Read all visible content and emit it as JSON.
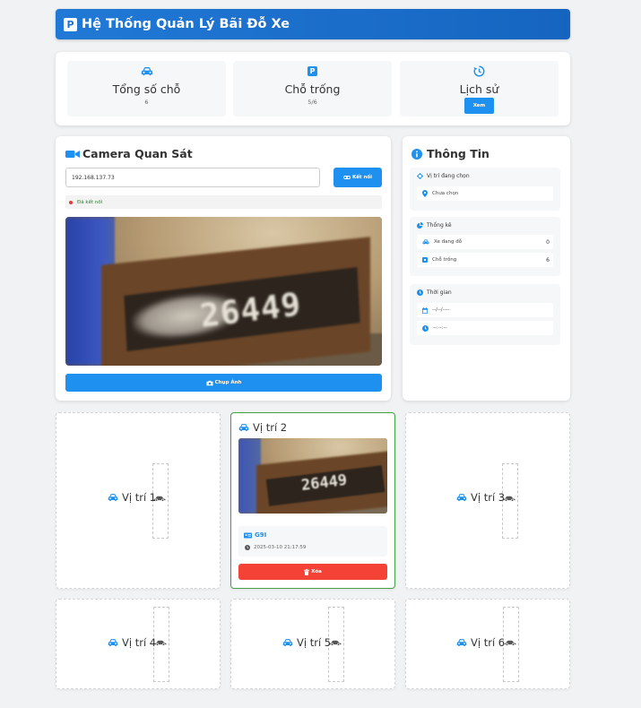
{
  "header": {
    "title": "Hệ Thống Quản Lý Bãi Đỗ Xe",
    "logo": "P"
  },
  "stats": {
    "total": {
      "label": "Tổng số chỗ",
      "value": "6"
    },
    "free": {
      "label": "Chỗ trống",
      "value": "5/6"
    },
    "history": {
      "label": "Lịch sử",
      "button": "Xem"
    }
  },
  "camera": {
    "title": "Camera Quan Sát",
    "ip_value": "192.168.137.73",
    "connect_button": "Kết nối",
    "status": "Đã kết nối",
    "plate_text": "26449",
    "capture_button": "Chụp Ảnh"
  },
  "info": {
    "title": "Thông Tin",
    "selected": {
      "heading": "Vị trí đang chọn",
      "value": "Chưa chọn"
    },
    "stats": {
      "heading": "Thống kê",
      "parked_label": "Xe đang đỗ",
      "parked_value": "0",
      "free_label": "Chỗ trống",
      "free_value": "6"
    },
    "time": {
      "heading": "Thời gian",
      "date": "--/--/----",
      "clock": "--:--:--"
    }
  },
  "spots": [
    {
      "label": "Vị trí 1"
    },
    {
      "label": "Vị trí 2",
      "plate": "G9I",
      "time": "2025-03-10 21:17:59",
      "delete_button": "Xóa",
      "snapshot_text": "26449"
    },
    {
      "label": "Vị trí 3"
    },
    {
      "label": "Vị trí 4"
    },
    {
      "label": "Vị trí 5"
    },
    {
      "label": "Vị trí 6"
    }
  ],
  "colors": {
    "primary": "#1e90f0",
    "header": "#1565c0",
    "danger": "#f44336",
    "success": "#43a047"
  }
}
